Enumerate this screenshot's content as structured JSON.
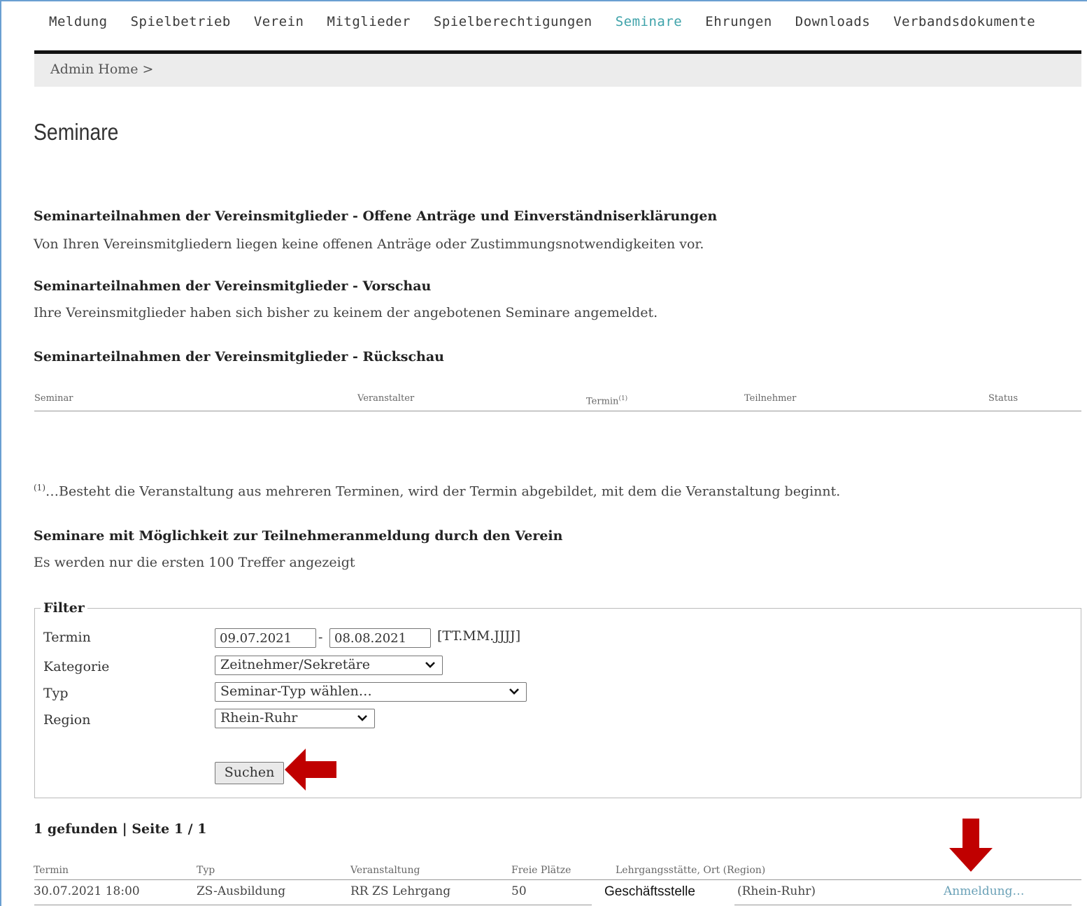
{
  "nav": {
    "items": [
      "Meldung",
      "Spielbetrieb",
      "Verein",
      "Mitglieder",
      "Spielberechtigungen",
      "Seminare",
      "Ehrungen",
      "Downloads",
      "Verbandsdokumente"
    ],
    "active_index": 5
  },
  "breadcrumb": "Admin Home >",
  "page_title": "Seminare",
  "section1": {
    "heading": "Seminarteilnahmen der Vereinsmitglieder - Offene Anträge und Einverständniserklärungen",
    "text": "Von Ihren Vereinsmitgliedern liegen keine offenen Anträge oder Zustimmungsnotwendigkeiten vor."
  },
  "section2": {
    "heading": "Seminarteilnahmen der Vereinsmitglieder - Vorschau",
    "text": "Ihre Vereinsmitglieder haben sich bisher zu keinem der angebotenen Seminare angemeldet."
  },
  "section3": {
    "heading": "Seminarteilnahmen der Vereinsmitglieder - Rückschau",
    "columns": [
      "Seminar",
      "Veranstalter",
      "Termin",
      "Teilnehmer",
      "Status"
    ],
    "termin_sup": "(1)"
  },
  "footnote": {
    "marker": "(1)",
    "text": "…Besteht die Veranstaltung aus mehreren Terminen, wird der Termin abgebildet, mit dem die Veranstaltung beginnt."
  },
  "section4": {
    "heading": "Seminare mit Möglichkeit zur Teilnehmeranmeldung durch den Verein",
    "text": "Es werden nur die ersten 100 Treffer angezeigt"
  },
  "filter": {
    "legend": "Filter",
    "termin_label": "Termin",
    "date_from": "09.07.2021",
    "date_to": "08.08.2021",
    "dash": "-",
    "date_format": "[TT.MM.JJJJ]",
    "kategorie_label": "Kategorie",
    "kategorie_value": "Zeitnehmer/Sekretäre",
    "typ_label": "Typ",
    "typ_value": "Seminar-Typ wählen…",
    "region_label": "Region",
    "region_value": "Rhein-Ruhr",
    "search_button": "Suchen"
  },
  "results": {
    "summary": "1 gefunden | Seite 1 / 1",
    "columns": [
      "Termin",
      "Typ",
      "Veranstaltung",
      "Freie Plätze",
      "Lehrgangsstätte, Ort (Region)"
    ],
    "rows": [
      {
        "termin": "30.07.2021 18:00",
        "typ": "ZS-Ausbildung",
        "veranstaltung": "RR ZS Lehrgang",
        "freie_plaetze": "50",
        "ort": "Geschäftsstelle",
        "region": "(Rhein-Ruhr)",
        "action": "Anmeldung…"
      }
    ]
  },
  "colors": {
    "accent": "#3fa3aa",
    "link": "#6aa1b7",
    "annotation_arrow": "#c00000",
    "frame": "#6a9fd1"
  }
}
